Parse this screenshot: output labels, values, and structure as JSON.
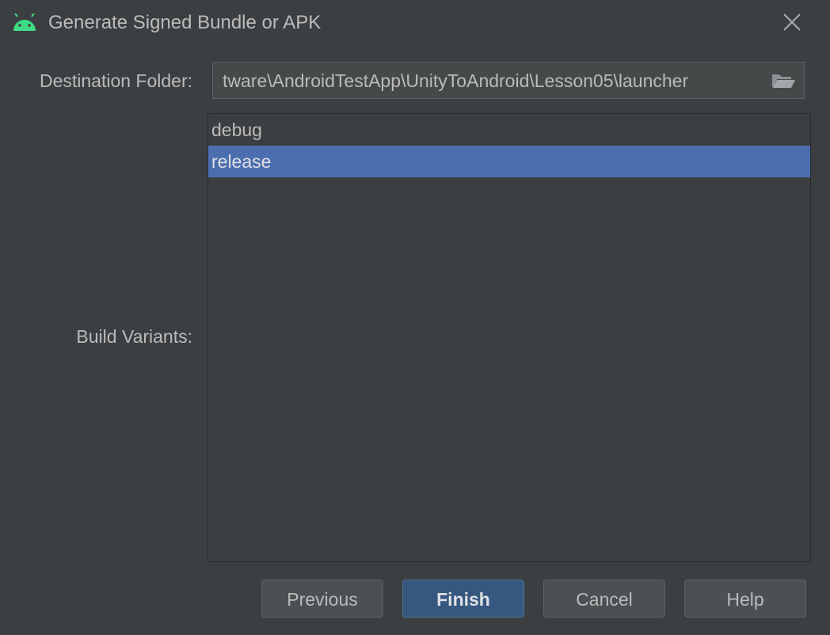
{
  "window": {
    "title": "Generate Signed Bundle or APK",
    "icon": "android-icon"
  },
  "form": {
    "destination_label": "Destination Folder:",
    "destination_value": "tware\\AndroidTestApp\\UnityToAndroid\\Lesson05\\launcher",
    "folder_icon": "folder-icon",
    "variants_label": "Build Variants:",
    "variants": [
      {
        "label": "debug",
        "selected": false
      },
      {
        "label": "release",
        "selected": true
      }
    ]
  },
  "buttons": {
    "previous": "Previous",
    "finish": "Finish",
    "cancel": "Cancel",
    "help": "Help"
  },
  "colors": {
    "background": "#3c3f41",
    "selection": "#4b6eaf",
    "primary_button": "#365880",
    "android_green": "#3ddc84"
  }
}
